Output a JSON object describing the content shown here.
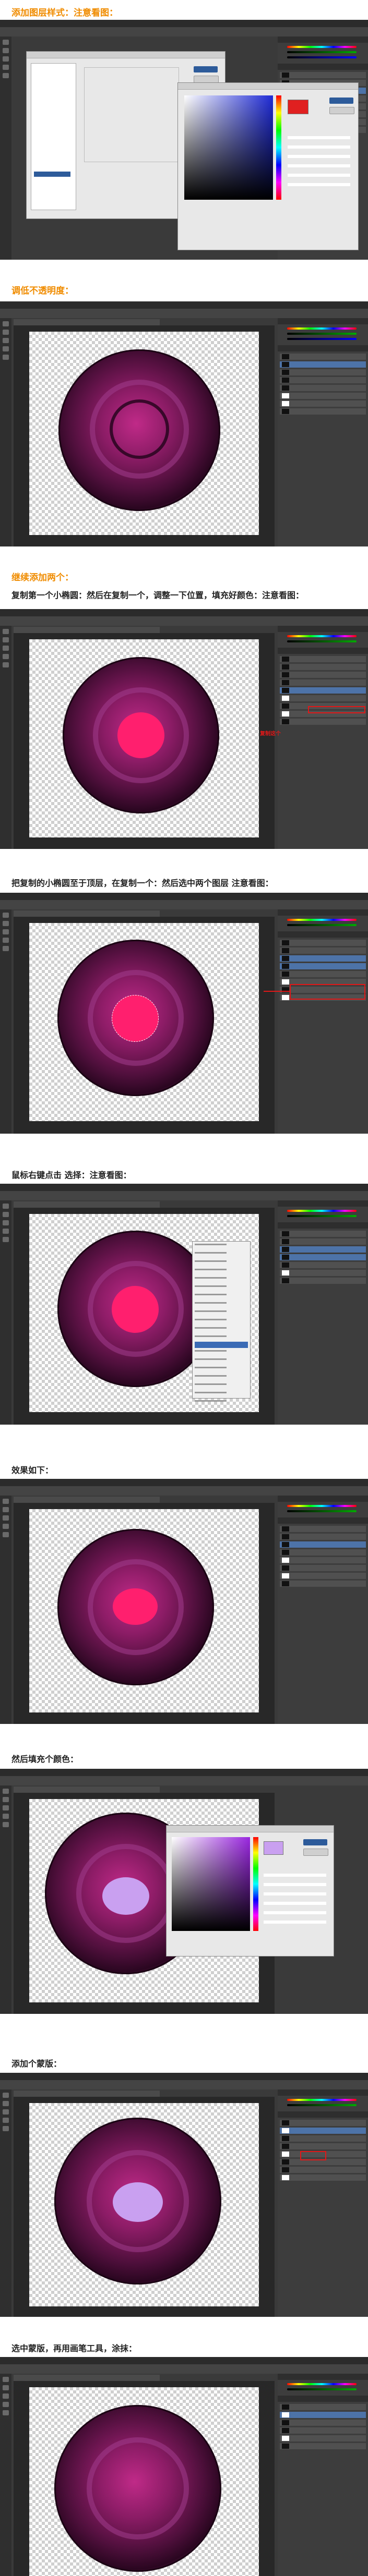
{
  "steps": [
    {
      "label": "添加图层样式：注意看图：",
      "style": "orange"
    },
    {
      "label": "调低不透明度：",
      "style": "orange"
    },
    {
      "label": "继续添加两个：",
      "style": "orange"
    },
    {
      "label": "复制第一个小椭圆：然后在复制一个，调整一下位置，填充好颜色：注意看图：",
      "style": "dark"
    },
    {
      "label": "把复制的小椭圆至于顶层，在复制一个：然后选中两个图层 注意看图：",
      "style": "dark"
    },
    {
      "label": "鼠标右键点击 选择：注意看图：",
      "style": "dark"
    },
    {
      "label": "效果如下：",
      "style": "dark"
    },
    {
      "label": "然后填充个颜色：",
      "style": "dark"
    },
    {
      "label": "添加个蒙版：",
      "style": "dark"
    },
    {
      "label": "选中蒙版，再用画笔工具，涂抹：",
      "style": "dark"
    }
  ],
  "annotations": {
    "copy_note": "复制这个"
  },
  "colors": {
    "orange_label": "#f08c00",
    "annotation_red": "#e01818",
    "pink_fill": "#ff1f6e",
    "lilac_fill": "#c9a0f0",
    "picker_red": "#e02020"
  },
  "icons": [
    "tool-icon",
    "layer-thumbnail-icon",
    "eye-icon"
  ]
}
